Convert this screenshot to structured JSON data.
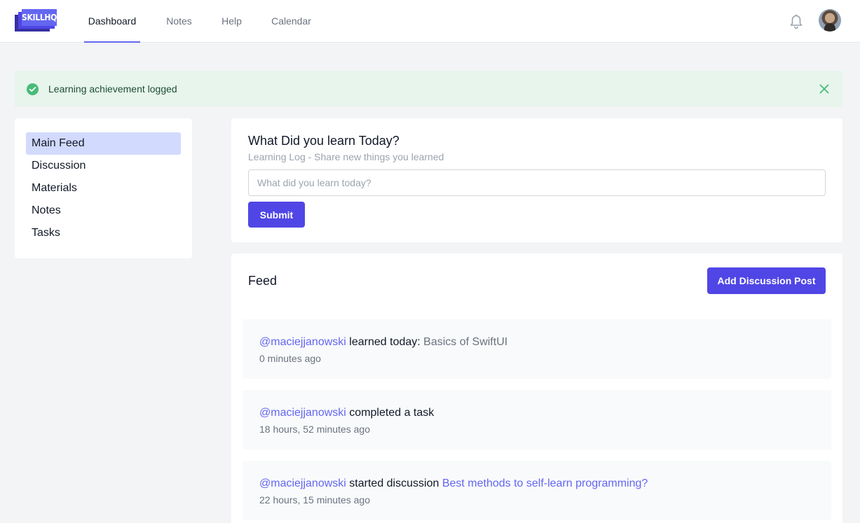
{
  "brand": {
    "logo_text": "SKILLHQ"
  },
  "nav": {
    "links": [
      "Dashboard",
      "Notes",
      "Help",
      "Calendar"
    ],
    "active": "Dashboard"
  },
  "alert": {
    "message": "Learning achievement logged"
  },
  "sidebar": {
    "items": [
      "Main Feed",
      "Discussion",
      "Materials",
      "Notes",
      "Tasks"
    ],
    "active": "Main Feed"
  },
  "learn": {
    "title": "What Did you learn Today?",
    "subtitle": "Learning Log - Share new things you learned",
    "input_placeholder": "What did you learn today?",
    "input_value": "",
    "submit_label": "Submit"
  },
  "feed": {
    "title": "Feed",
    "add_button_label": "Add Discussion Post",
    "items": [
      {
        "user": "@maciejjanowski",
        "action": "learned today:",
        "object": "Basics of SwiftUI",
        "time": "0 minutes ago"
      },
      {
        "user": "@maciejjanowski",
        "action": "completed a task",
        "object": "",
        "time": "18 hours, 52 minutes ago"
      },
      {
        "user": "@maciejjanowski",
        "action": "started discussion",
        "object": "Best methods to self-learn programming?",
        "time": "22 hours, 15 minutes ago"
      }
    ]
  },
  "colors": {
    "accent": "#5046e5",
    "link": "#6366f1",
    "alert_bg": "#e7f5ec",
    "success": "#48bb78",
    "sidebar_active_bg": "#d2dafd",
    "page_bg": "#f3f4f6"
  },
  "icons": {
    "notifications": "bell-icon",
    "alert_status": "check-circle-icon",
    "alert_close": "close-icon"
  }
}
